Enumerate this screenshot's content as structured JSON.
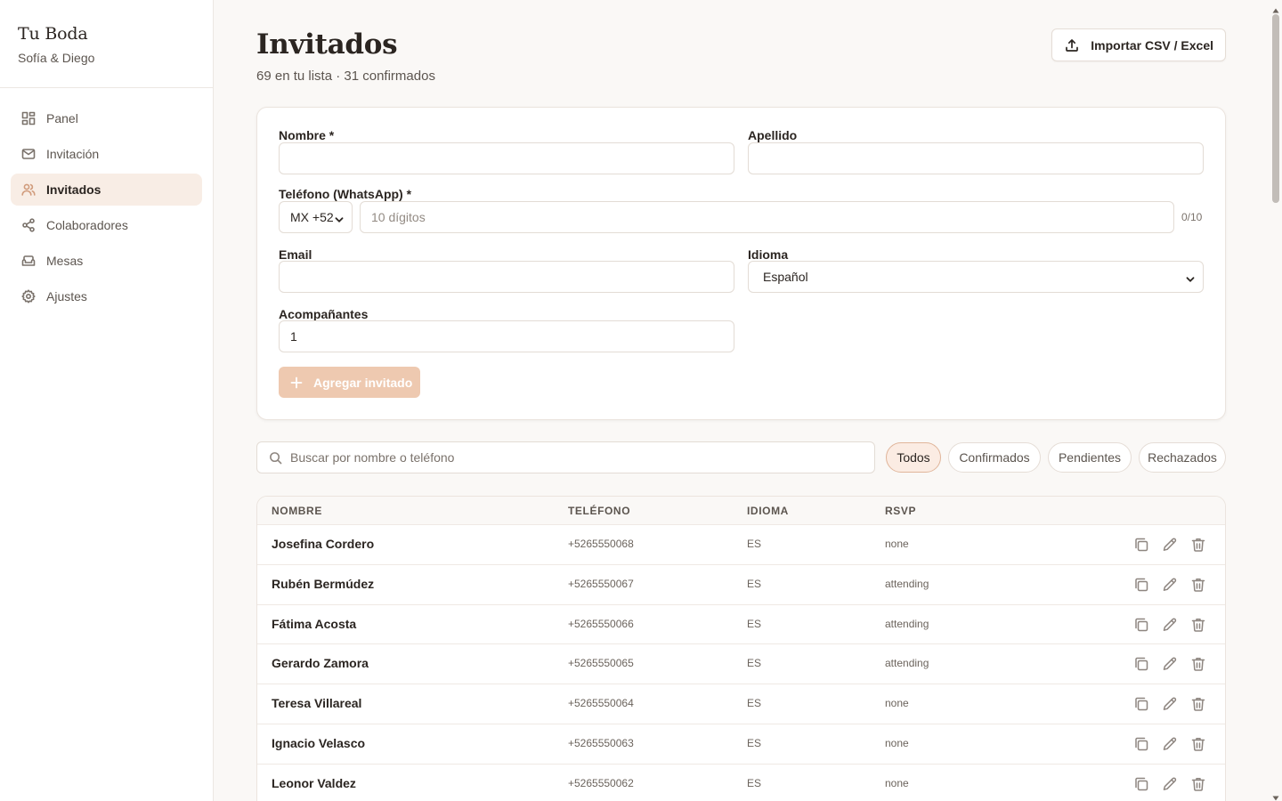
{
  "brand": {
    "title": "Tu Boda",
    "subtitle": "Sofía & Diego"
  },
  "nav": [
    {
      "label": "Panel",
      "icon": "dashboard-icon"
    },
    {
      "label": "Invitación",
      "icon": "mail-icon"
    },
    {
      "label": "Invitados",
      "icon": "users-icon",
      "active": true
    },
    {
      "label": "Colaboradores",
      "icon": "share-icon"
    },
    {
      "label": "Mesas",
      "icon": "sofa-icon"
    },
    {
      "label": "Ajustes",
      "icon": "gear-icon"
    }
  ],
  "header": {
    "title": "Invitados",
    "subtitle": "69 en tu lista · 31 confirmados",
    "import_label": "Importar CSV / Excel"
  },
  "form": {
    "nombre_label": "Nombre *",
    "nombre_value": "",
    "apellido_label": "Apellido",
    "apellido_value": "",
    "telefono_label": "Teléfono (WhatsApp) *",
    "country_code": "MX +52",
    "telefono_placeholder": "10 dígitos",
    "telefono_counter": "0/10",
    "email_label": "Email",
    "email_value": "",
    "idioma_label": "Idioma",
    "idioma_value": "Español",
    "acompanantes_label": "Acompañantes",
    "acompanantes_value": "1",
    "submit_label": "Agregar invitado"
  },
  "filters": {
    "search_placeholder": "Buscar por nombre o teléfono",
    "chips": [
      "Todos",
      "Confirmados",
      "Pendientes",
      "Rechazados"
    ],
    "active_chip": "Todos"
  },
  "table": {
    "columns": [
      "NOMBRE",
      "TELÉFONO",
      "IDIOMA",
      "RSVP"
    ],
    "rows": [
      {
        "name": "Josefina Cordero",
        "phone": "+5265550068",
        "lang": "ES",
        "rsvp": "none"
      },
      {
        "name": "Rubén Bermúdez",
        "phone": "+5265550067",
        "lang": "ES",
        "rsvp": "attending"
      },
      {
        "name": "Fátima Acosta",
        "phone": "+5265550066",
        "lang": "ES",
        "rsvp": "attending"
      },
      {
        "name": "Gerardo Zamora",
        "phone": "+5265550065",
        "lang": "ES",
        "rsvp": "attending"
      },
      {
        "name": "Teresa Villareal",
        "phone": "+5265550064",
        "lang": "ES",
        "rsvp": "none"
      },
      {
        "name": "Ignacio Velasco",
        "phone": "+5265550063",
        "lang": "ES",
        "rsvp": "none"
      },
      {
        "name": "Leonor Valdez",
        "phone": "+5265550062",
        "lang": "ES",
        "rsvp": "none"
      }
    ]
  },
  "colors": {
    "accent": "#d19c7c",
    "accent_soft": "#f8ede5",
    "button_disabled": "#eec9b0"
  }
}
